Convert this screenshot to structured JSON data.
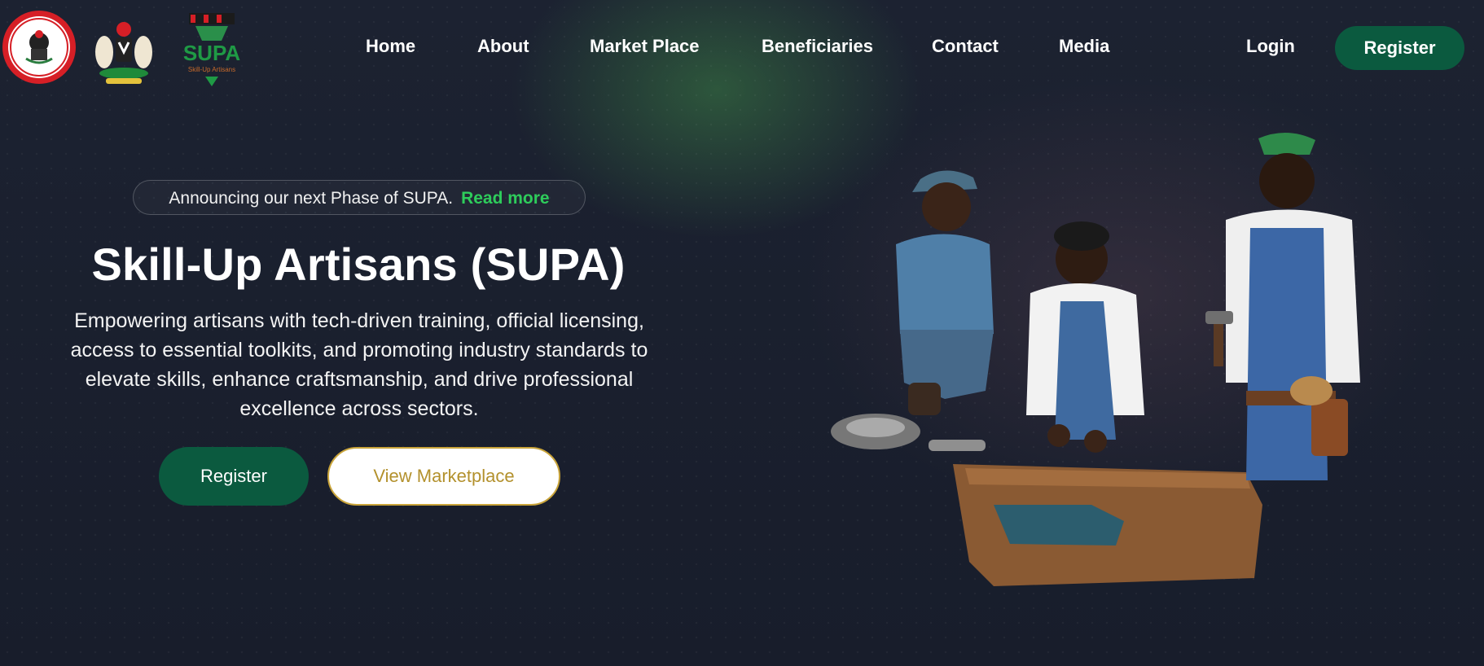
{
  "logos": [
    {
      "name": "industrial-training-fund-logo",
      "text": "INDUSTRIAL TRAINING FUND"
    },
    {
      "name": "coat-of-arms-logo",
      "text": ""
    },
    {
      "name": "supa-logo",
      "text": "ITF SUPA"
    }
  ],
  "nav": {
    "items": [
      "Home",
      "About",
      "Market Place",
      "Beneficiaries",
      "Contact",
      "Media"
    ],
    "login": "Login",
    "register": "Register"
  },
  "hero": {
    "announcement": "Announcing our next Phase of SUPA.",
    "read_more": "Read more",
    "title": "Skill-Up Artisans (SUPA)",
    "subtitle": "Empowering artisans with tech-driven training, official licensing, access to essential toolkits, and promoting industry standards to elevate skills, enhance craftsmanship, and drive professional excellence across sectors.",
    "primary_button": "Register",
    "secondary_button": "View Marketplace",
    "image_description": "artisans-at-workbench"
  },
  "colors": {
    "brand_green": "#0b5a3f",
    "link_green": "#2ecc5b",
    "gold": "#b3912d",
    "background": "#1a1f2e"
  }
}
